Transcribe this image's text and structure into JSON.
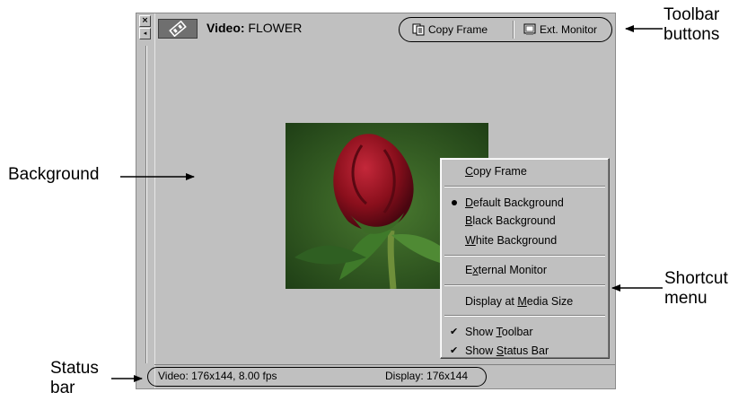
{
  "callouts": {
    "toolbar_buttons": "Toolbar\nbuttons",
    "background": "Background",
    "shortcut_menu": "Shortcut\nmenu",
    "status_bar": "Status\nbar"
  },
  "window": {
    "close_glyph": "×",
    "collapse_glyph": "◂",
    "title_icon": "video-icon",
    "title_label": "Video:",
    "title_name": "FLOWER"
  },
  "toolbar": {
    "copy_frame": "Copy Frame",
    "copy_frame_icon": "copy-icon",
    "ext_monitor": "Ext. Monitor",
    "ext_monitor_icon": "monitor-icon"
  },
  "statusbar": {
    "video_info": "Video: 176x144, 8.00 fps",
    "display_info": "Display: 176x144"
  },
  "menu": {
    "copy_frame": {
      "pre": "",
      "key": "C",
      "post": "opy Frame"
    },
    "default_background": {
      "pre": "",
      "key": "D",
      "post": "efault Background",
      "selected": true
    },
    "black_background": {
      "pre": "",
      "key": "B",
      "post": "lack Background"
    },
    "white_background": {
      "pre": "",
      "key": "W",
      "post": "hite Background"
    },
    "external_monitor": {
      "pre": "E",
      "key": "x",
      "post": "ternal Monitor"
    },
    "display_media_size": {
      "pre": "Display at ",
      "key": "M",
      "post": "edia Size"
    },
    "show_toolbar": {
      "pre": "Show ",
      "key": "T",
      "post": "oolbar",
      "checked": true
    },
    "show_status_bar": {
      "pre": "Show ",
      "key": "S",
      "post": "tatus Bar",
      "checked": true
    },
    "check_glyph": "✔"
  },
  "colors": {
    "window_bg": "#c0c0c0",
    "menu_bg": "#c0c0c0",
    "rose": "#8a0f1c",
    "foliage": "#2e5a22"
  }
}
